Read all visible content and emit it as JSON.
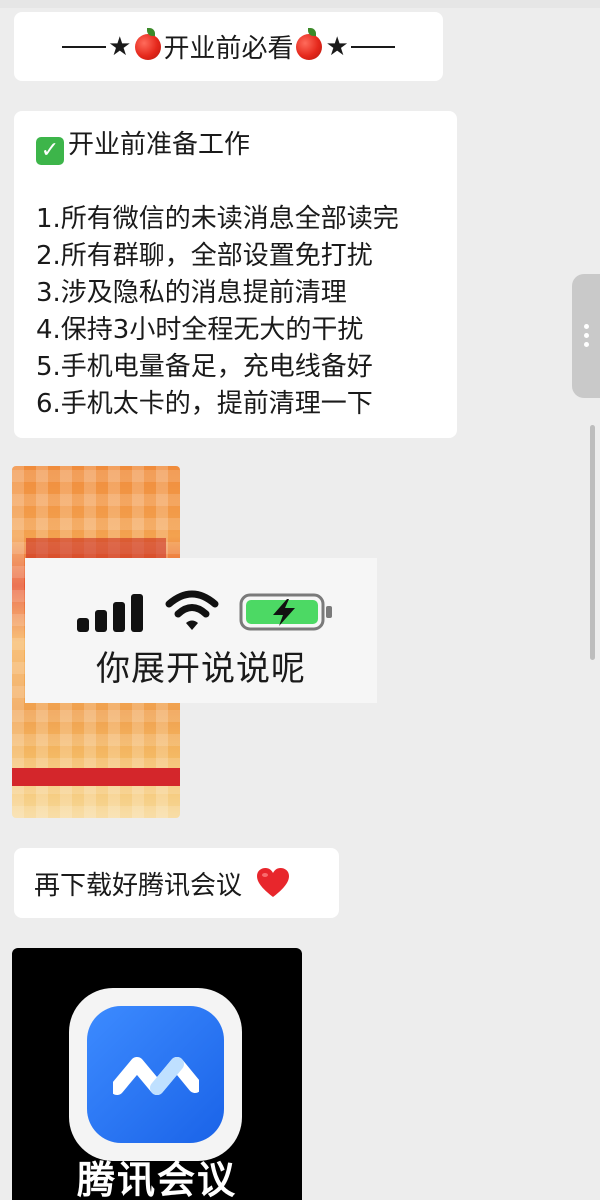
{
  "messages": {
    "header": {
      "dash_left": "——",
      "star": "★",
      "text": "开业前必看",
      "dash_right": "——",
      "icon": "apple-emoji"
    },
    "checklist": {
      "icon": "check-mark-emoji",
      "title": "开业前准备工作",
      "items": [
        "1.所有微信的未读消息全部读完",
        "2.所有群聊，全部设置免打扰",
        "3.涉及隐私的消息提前清理",
        "4.保持3小时全程无大的干扰",
        "5.手机电量备足，充电线备好",
        "6.手机太卡的，提前清理一下"
      ]
    },
    "image_status": {
      "caption": "你展开说说呢",
      "icons": [
        "signal-bars",
        "wifi",
        "battery-charging"
      ],
      "battery_color": "#4cd964"
    },
    "download_note": {
      "text": "再下载好腾讯会议",
      "icon": "red-heart-emoji"
    },
    "app_image": {
      "label": "腾讯会议",
      "accent": "#2a75f3"
    }
  },
  "colors": {
    "background": "#ededed",
    "bubble": "#ffffff",
    "check_green": "#3db54a",
    "heart_red": "#e8262c"
  }
}
